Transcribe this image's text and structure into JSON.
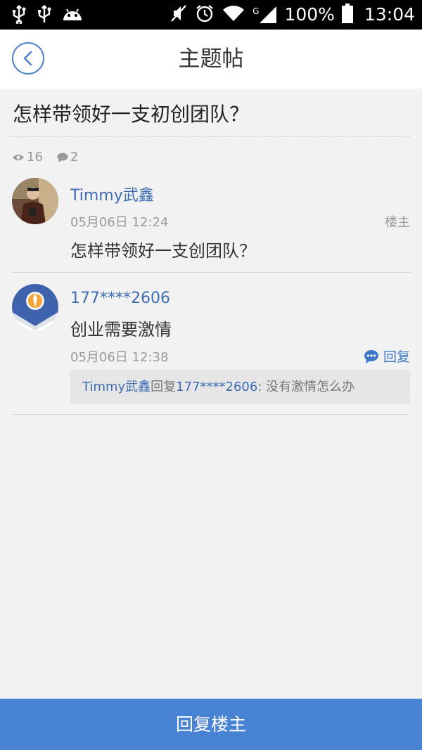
{
  "status_bar": {
    "battery": "100%",
    "time": "13:04",
    "network": "G"
  },
  "header": {
    "title": "主题帖"
  },
  "topic": {
    "title": "怎样带领好一支初创团队？",
    "views": "16",
    "comments": "2"
  },
  "posts": [
    {
      "username": "Timmy武鑫",
      "timestamp": "05月06日 12:24",
      "floor_label": "楼主",
      "content": "怎样带领好一支创团队？"
    },
    {
      "username": "177****2606",
      "content": "创业需要激情",
      "timestamp": "05月06日 12:38",
      "reply_label": "回复",
      "quote": {
        "from": "Timmy武鑫",
        "verb": "回复",
        "to": "177****2606",
        "text": ": 没有激情怎么办"
      }
    }
  ],
  "bottom": {
    "reply_owner_label": "回复楼主"
  },
  "colors": {
    "accent": "#4882d2",
    "link": "#3e6db5"
  }
}
